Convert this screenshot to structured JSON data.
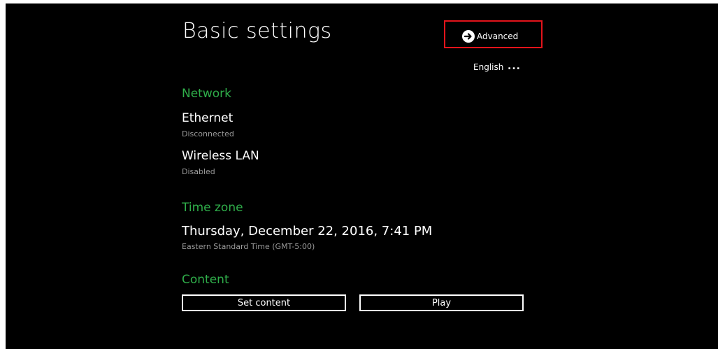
{
  "header": {
    "title": "Basic settings",
    "advanced_label": "Advanced",
    "advanced_icon": "arrow-right-circle-icon",
    "language": "English",
    "language_more": "..."
  },
  "network": {
    "section_label": "Network",
    "ethernet": {
      "name": "Ethernet",
      "status": "Disconnected"
    },
    "wireless": {
      "name": "Wireless LAN",
      "status": "Disabled"
    }
  },
  "timezone": {
    "section_label": "Time zone",
    "datetime": "Thursday, December 22, 2016, 7:41 PM",
    "zone": "Eastern Standard Time (GMT-5:00)"
  },
  "content": {
    "section_label": "Content",
    "set_content_label": "Set content",
    "play_label": "Play"
  },
  "colors": {
    "background": "#000000",
    "section_accent": "#2fae4a",
    "highlight_box": "#e3141b",
    "text": "#ffffff",
    "subtext": "#9a9a9a"
  }
}
